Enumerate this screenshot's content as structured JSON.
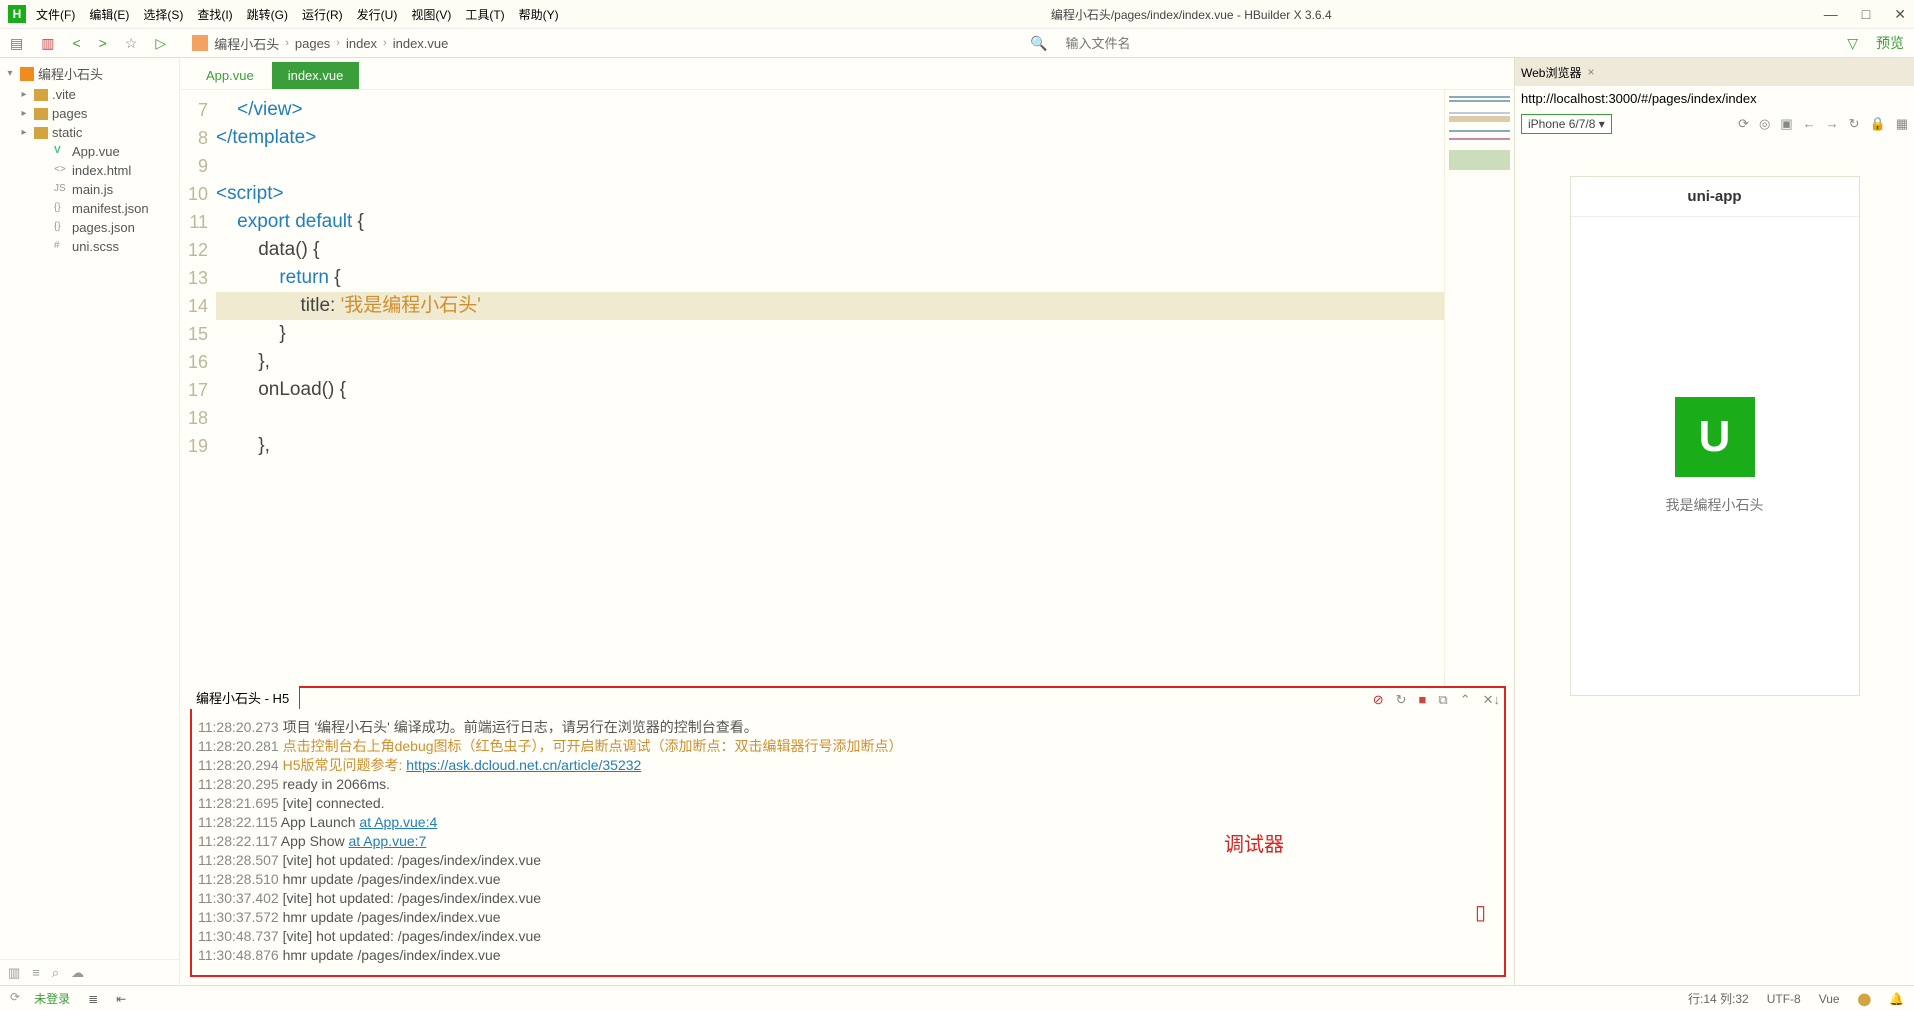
{
  "app": {
    "icon_letter": "H",
    "version": "3.6.4"
  },
  "menubar": [
    "文件(F)",
    "编辑(E)",
    "选择(S)",
    "查找(I)",
    "跳转(G)",
    "运行(R)",
    "发行(U)",
    "视图(V)",
    "工具(T)",
    "帮助(Y)"
  ],
  "window_title": "编程小石头/pages/index/index.vue - HBuilder X 3.6.4",
  "toolbar": {
    "breadcrumb": [
      "编程小石头",
      "pages",
      "index",
      "index.vue"
    ],
    "search_placeholder": "输入文件名",
    "preview_label": "预览"
  },
  "tree": {
    "project": "编程小石头",
    "items": [
      {
        "name": ".vite",
        "type": "folder",
        "indent": 1
      },
      {
        "name": "pages",
        "type": "folder",
        "indent": 1
      },
      {
        "name": "static",
        "type": "folder",
        "indent": 1
      },
      {
        "name": "App.vue",
        "type": "vue",
        "indent": 2
      },
      {
        "name": "index.html",
        "type": "html",
        "indent": 2
      },
      {
        "name": "main.js",
        "type": "js",
        "indent": 2
      },
      {
        "name": "manifest.json",
        "type": "json",
        "indent": 2
      },
      {
        "name": "pages.json",
        "type": "json",
        "indent": 2
      },
      {
        "name": "uni.scss",
        "type": "scss",
        "indent": 2
      }
    ]
  },
  "tabs": [
    {
      "label": "App.vue",
      "active": false
    },
    {
      "label": "index.vue",
      "active": true
    }
  ],
  "editor": {
    "line_start": 7,
    "lines": [
      {
        "n": 7,
        "html": "    <span class='tag'>&lt;/view&gt;</span>"
      },
      {
        "n": 8,
        "html": "<span class='tag'>&lt;/template&gt;</span>"
      },
      {
        "n": 9,
        "html": ""
      },
      {
        "n": 10,
        "html": "<span class='tag'>&lt;script&gt;</span>"
      },
      {
        "n": 11,
        "html": "    <span class='kw'>export</span> <span class='kw'>default</span> <span class='id'>{</span>"
      },
      {
        "n": 12,
        "html": "        <span class='id'>data() {</span>"
      },
      {
        "n": 13,
        "html": "            <span class='kw'>return</span> <span class='id'>{</span>"
      },
      {
        "n": 14,
        "html": "                <span class='id'>title:</span> <span class='str'>'我是编程小石头'</span>",
        "hl": true
      },
      {
        "n": 15,
        "html": "            <span class='id'>}</span>"
      },
      {
        "n": 16,
        "html": "        <span class='id'>},</span>"
      },
      {
        "n": 17,
        "html": "        <span class='id'>onLoad() {</span>"
      },
      {
        "n": 18,
        "html": ""
      },
      {
        "n": 19,
        "html": "        <span class='id'>},</span>"
      }
    ]
  },
  "console": {
    "tab_label": "编程小石头 - H5",
    "annotation": "调试器",
    "lines": [
      {
        "ts": "11:28:20.273",
        "html": "项目 '编程小石头' 编译成功。前端运行日志，请另行在浏览器的控制台查看。"
      },
      {
        "ts": "11:28:20.281",
        "html": "<span class='txt-orange'>点击控制台右上角debug图标（红色虫子），可开启断点调试（添加断点：双击编辑器行号添加断点）</span>"
      },
      {
        "ts": "11:28:20.294",
        "html": "<span class='txt-orange'>H5版常见问题参考:</span> <span class='link'>https://ask.dcloud.net.cn/article/35232</span>"
      },
      {
        "ts": "11:28:20.295",
        "html": "  ready in 2066ms."
      },
      {
        "ts": "11:28:21.695",
        "html": "[vite] connected."
      },
      {
        "ts": "11:28:22.115",
        "html": "App Launch <span class='link'>at App.vue:4</span>"
      },
      {
        "ts": "11:28:22.117",
        "html": "App Show <span class='link'>at App.vue:7</span>"
      },
      {
        "ts": "11:28:28.507",
        "html": "[vite] hot updated: /pages/index/index.vue"
      },
      {
        "ts": "11:28:28.510",
        "html": "hmr update /pages/index/index.vue"
      },
      {
        "ts": "11:30:37.402",
        "html": "[vite] hot updated: /pages/index/index.vue"
      },
      {
        "ts": "11:30:37.572",
        "html": "hmr update /pages/index/index.vue"
      },
      {
        "ts": "11:30:48.737",
        "html": "[vite] hot updated: /pages/index/index.vue"
      },
      {
        "ts": "11:30:48.876",
        "html": "hmr update /pages/index/index.vue"
      }
    ]
  },
  "preview": {
    "tab_label": "Web浏览器",
    "url": "http://localhost:3000/#/pages/index/index",
    "device": "iPhone 6/7/8",
    "phone_header": "uni-app",
    "phone_logo": "U",
    "phone_text": "我是编程小石头"
  },
  "statusbar": {
    "login": "未登录",
    "cursor": "行:14 列:32",
    "encoding": "UTF-8",
    "lang": "Vue"
  }
}
